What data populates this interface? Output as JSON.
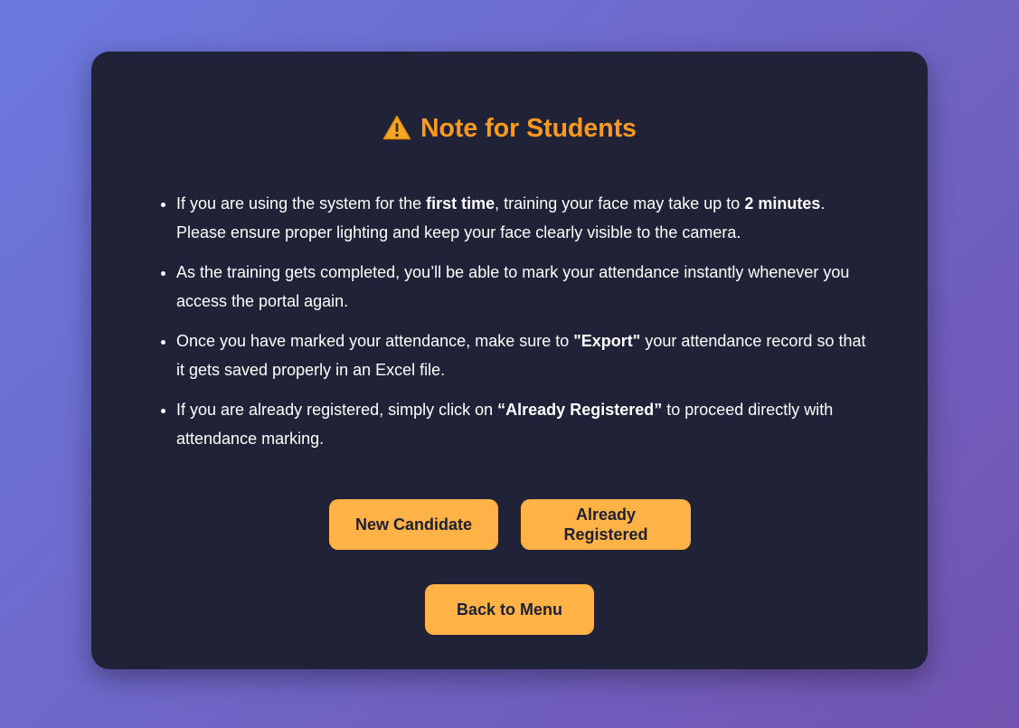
{
  "header": {
    "title": "Note for Students",
    "icon": "warning-icon",
    "title_color": "#ff9a1f"
  },
  "notes": [
    {
      "before": "If you are using the system for the ",
      "bold1": "first time",
      "middle": ", training your face may take up to ",
      "bold2": "2 minutes",
      "after": ". Please ensure proper lighting and keep your face clearly visible to the camera."
    },
    {
      "text": "As the training gets completed, you’ll be able to mark your attendance instantly whenever you access the portal again."
    },
    {
      "before": "Once you have marked your attendance, make sure to ",
      "bold": "\"Export\"",
      "after": " your attendance record so that it gets saved properly in an Excel file."
    },
    {
      "before": "If you are already registered, simply click on ",
      "bold": "“Already Registered”",
      "after": " to proceed directly with attendance marking."
    }
  ],
  "buttons": {
    "new_candidate": "New Candidate",
    "already_registered": "Already Registered",
    "back_to_menu": "Back to Menu"
  },
  "colors": {
    "card_background": "#202237",
    "button_background": "#ffb347",
    "button_text": "#1e1f33"
  }
}
